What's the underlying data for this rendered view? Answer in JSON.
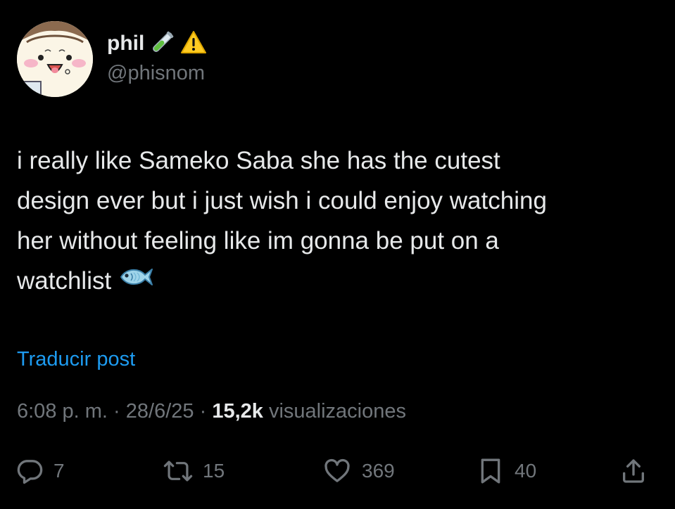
{
  "author": {
    "display_name": "phil",
    "handle": "@phisnom",
    "name_emojis": [
      "test-tube-emoji",
      "warning-emoji"
    ]
  },
  "post": {
    "text_lines": [
      "i really like Sameko Saba she has the cutest",
      "design ever but i just wish i could enjoy watching",
      "her without feeling like im gonna be put on a",
      "watchlist"
    ],
    "trailing_emoji": "fish-emoji",
    "translate_label": "Traducir post",
    "time": "6:08 p. m.",
    "separator": "·",
    "date": "28/6/25",
    "views_count": "15,2k",
    "views_label": "visualizaciones"
  },
  "actions": {
    "replies": "7",
    "reposts": "15",
    "likes": "369",
    "bookmarks": "40"
  },
  "colors": {
    "background": "#000000",
    "primary_text": "#e7e9ea",
    "secondary_text": "#71767b",
    "link": "#1d9bf0"
  }
}
